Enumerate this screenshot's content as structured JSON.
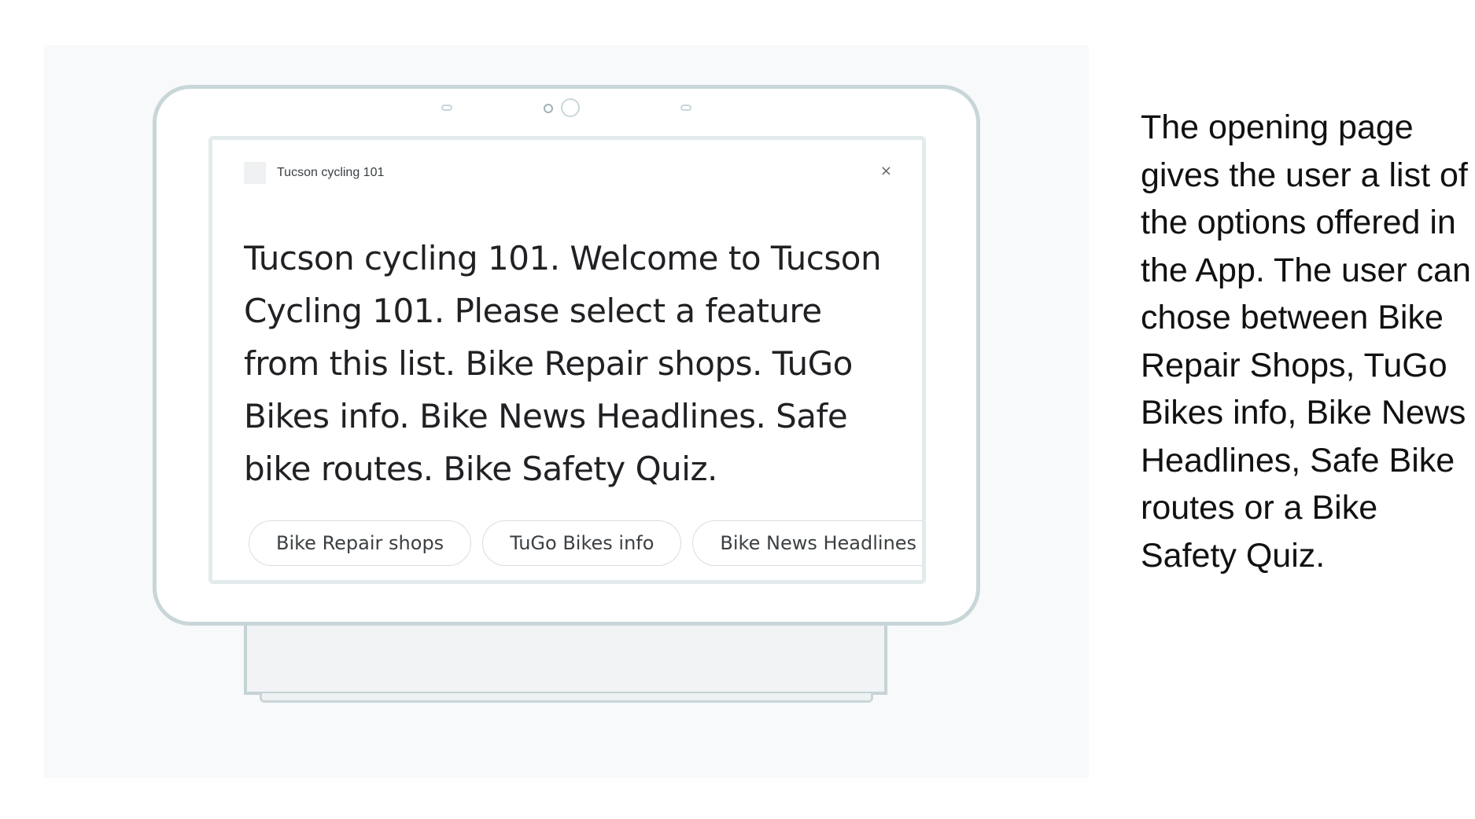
{
  "device": {
    "app_name": "Tucson cycling 101",
    "close_glyph": "×",
    "message_text": "Tucson cycling 101. Welcome to Tucson Cycling 101. Please select a feature from this list. Bike Repair shops. TuGo Bikes info. Bike News Headlines. Safe bike routes. Bike Safety Quiz.",
    "chips": [
      {
        "label": "Bike Repair shops"
      },
      {
        "label": "TuGo Bikes info"
      },
      {
        "label": "Bike News Headlines"
      }
    ],
    "icons": {
      "app": "app-icon",
      "close": "close-icon"
    }
  },
  "caption": {
    "text": "The opening page gives the user a list of the options offered in the App. The user can chose between Bike Repair Shops, TuGo Bikes info, Bike News Headlines, Safe Bike routes or a Bike Safety Quiz."
  },
  "colors": {
    "frame_border": "#c8d6d9",
    "stage_background": "#f7f9fa",
    "text_primary": "#202124",
    "chip_border": "#dadce0"
  }
}
